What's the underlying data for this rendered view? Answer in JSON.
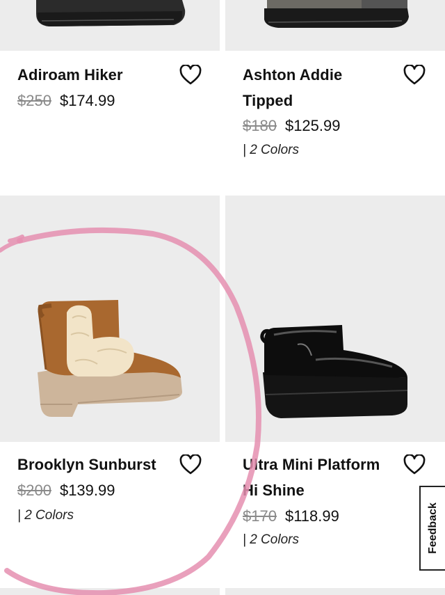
{
  "products": [
    {
      "name": "Adiroam Hiker",
      "old_price": "$250",
      "new_price": "$174.99",
      "colors": ""
    },
    {
      "name": "Ashton Addie Tipped",
      "old_price": "$180",
      "new_price": "$125.99",
      "colors": "| 2 Colors"
    },
    {
      "name": "Brooklyn Sunburst",
      "old_price": "$200",
      "new_price": "$139.99",
      "colors": "| 2 Colors"
    },
    {
      "name": "Ultra Mini Platform Hi Shine",
      "old_price": "$170",
      "new_price": "$118.99",
      "colors": "| 2 Colors"
    }
  ],
  "feedback": {
    "label": "Feedback"
  },
  "icons": {
    "wishlist": "heart-outline-icon"
  },
  "colors": {
    "image_bg": "#ececec",
    "old_price": "#8a8a8a",
    "annotation": "#e58fb0"
  }
}
